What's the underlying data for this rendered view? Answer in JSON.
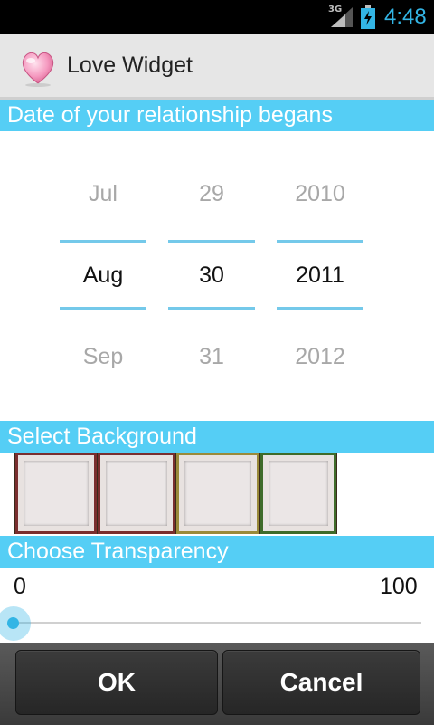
{
  "status_bar": {
    "network": "3G",
    "time": "4:48",
    "accent_color": "#33b5e5"
  },
  "app": {
    "title": "Love Widget",
    "icon": "heart-icon"
  },
  "date_section": {
    "header": "Date of your relationship begans",
    "month": {
      "prev": "Jul",
      "selected": "Aug",
      "next": "Sep"
    },
    "day": {
      "prev": "29",
      "selected": "30",
      "next": "31"
    },
    "year": {
      "prev": "2010",
      "selected": "2011",
      "next": "2012"
    }
  },
  "background_section": {
    "header": "Select Background",
    "swatches": [
      {
        "frame_color": "#7a2e2e"
      },
      {
        "frame_color": "#7a2e2e"
      },
      {
        "frame_color": "#9a8a3a"
      },
      {
        "frame_color": "#3f6b2a"
      }
    ]
  },
  "transparency_section": {
    "header": "Choose Transparency",
    "min_label": "0",
    "max_label": "100",
    "value": 0
  },
  "buttons": {
    "ok_label": "OK",
    "cancel_label": "Cancel"
  },
  "colors": {
    "section_header_bg": "#55cef5",
    "picker_line": "#74c9ea"
  }
}
